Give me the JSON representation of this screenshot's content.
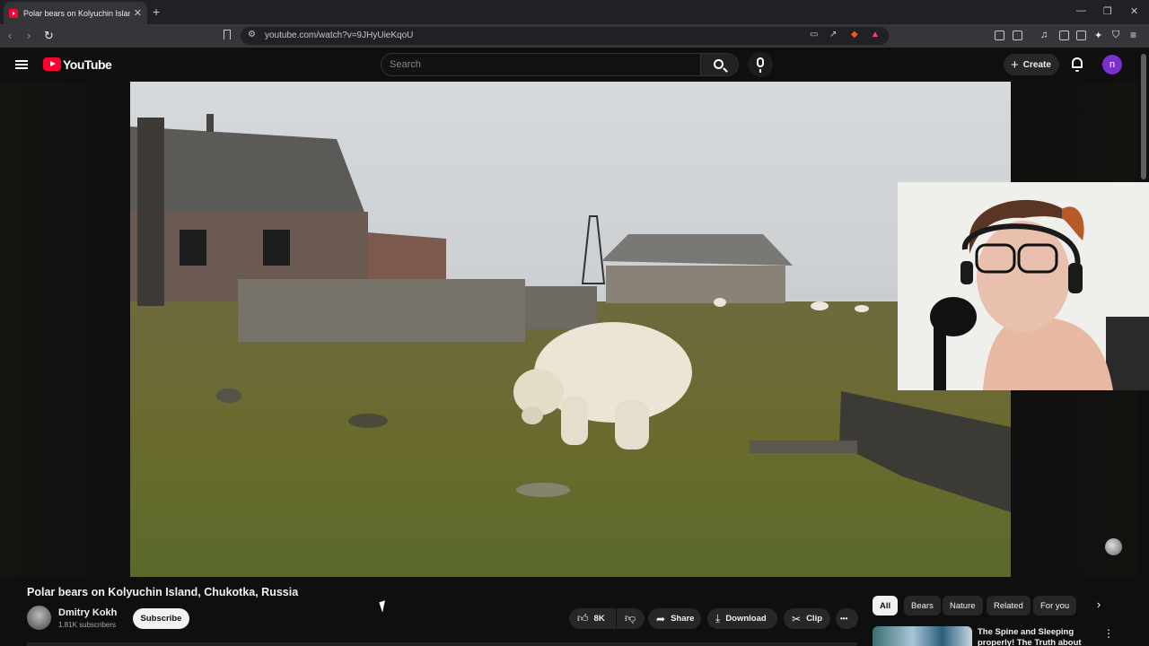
{
  "browser": {
    "tab_title": "Polar bears on Kolyuchin Island,",
    "tab_close": "✕",
    "new_tab": "+",
    "url": "youtube.com/watch?v=9JHyUieKqoU",
    "window_controls": [
      "—",
      "❐",
      "✕"
    ]
  },
  "youtube_header": {
    "logo_text": "YouTube",
    "search_placeholder": "Search",
    "create_label": "Create",
    "avatar_letter": "n",
    "brand_color": "#ff0033"
  },
  "video": {
    "title": "Polar bears on Kolyuchin Island, Chukotka, Russia",
    "channel_name": "Dmitry Kokh",
    "subscribers": "1.81K subscribers",
    "subscribe_label": "Subscribe",
    "like_count": "8K",
    "share_label": "Share",
    "download_label": "Download",
    "clip_label": "Clip",
    "more_label": "•••"
  },
  "filter_chips": [
    "All",
    "Bears",
    "Nature",
    "Related",
    "For you"
  ],
  "recommendation": {
    "title": "The Spine and Sleeping properly! The Truth about Beds!"
  }
}
